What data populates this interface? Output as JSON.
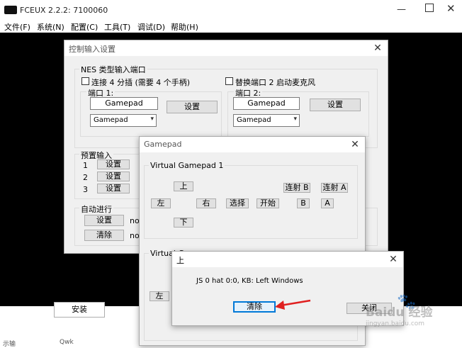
{
  "main": {
    "title": "FCEUX 2.2.2: 7100060",
    "menu": [
      "文件(F)",
      "系统(N)",
      "配置(C)",
      "工具(T)",
      "调试(D)",
      "帮助(H)"
    ],
    "bottom_button": "安装",
    "bottom_text1": "示输",
    "bottom_text2": "Qwk"
  },
  "input_config": {
    "title": "控制输入设置",
    "nes_group": "NES 类型输入端口",
    "four_score": "连接 4 分插 (需要 4 个手柄)",
    "port2_mic": "替换端口 2 启动麦克风",
    "port1_label": "端口 1:",
    "port2_label": "端口 2:",
    "port1_device": "Gamepad",
    "port2_device": "Gamepad",
    "configure": "设置",
    "port1_select": "Gamepad",
    "port2_select": "Gamepad",
    "presets_label": "预置输入",
    "preset_numbers": [
      "1",
      "2",
      "3"
    ],
    "auto_label": "自动进行",
    "auto_configure": "设置",
    "auto_clear": "清除",
    "not_text": "not"
  },
  "gamepad": {
    "title": "Gamepad",
    "group1": "Virtual Gamepad 1",
    "up": "上",
    "down": "下",
    "left": "左",
    "right": "右",
    "select": "选择",
    "start": "开始",
    "turbo_b": "连射 B",
    "turbo_a": "连射 A",
    "b": "B",
    "a": "A",
    "group2": "Virtual G",
    "left2": "左"
  },
  "button_dialog": {
    "title": "上",
    "message": "JS 0 hat 0:0, KB: Left Windows",
    "clear": "清除",
    "close": "关闭"
  },
  "watermark": {
    "text": "Baidu 经验",
    "url": "jingyan.baidu.com"
  },
  "colors": {
    "arrow": "#e02020",
    "focus": "#0078d7"
  }
}
